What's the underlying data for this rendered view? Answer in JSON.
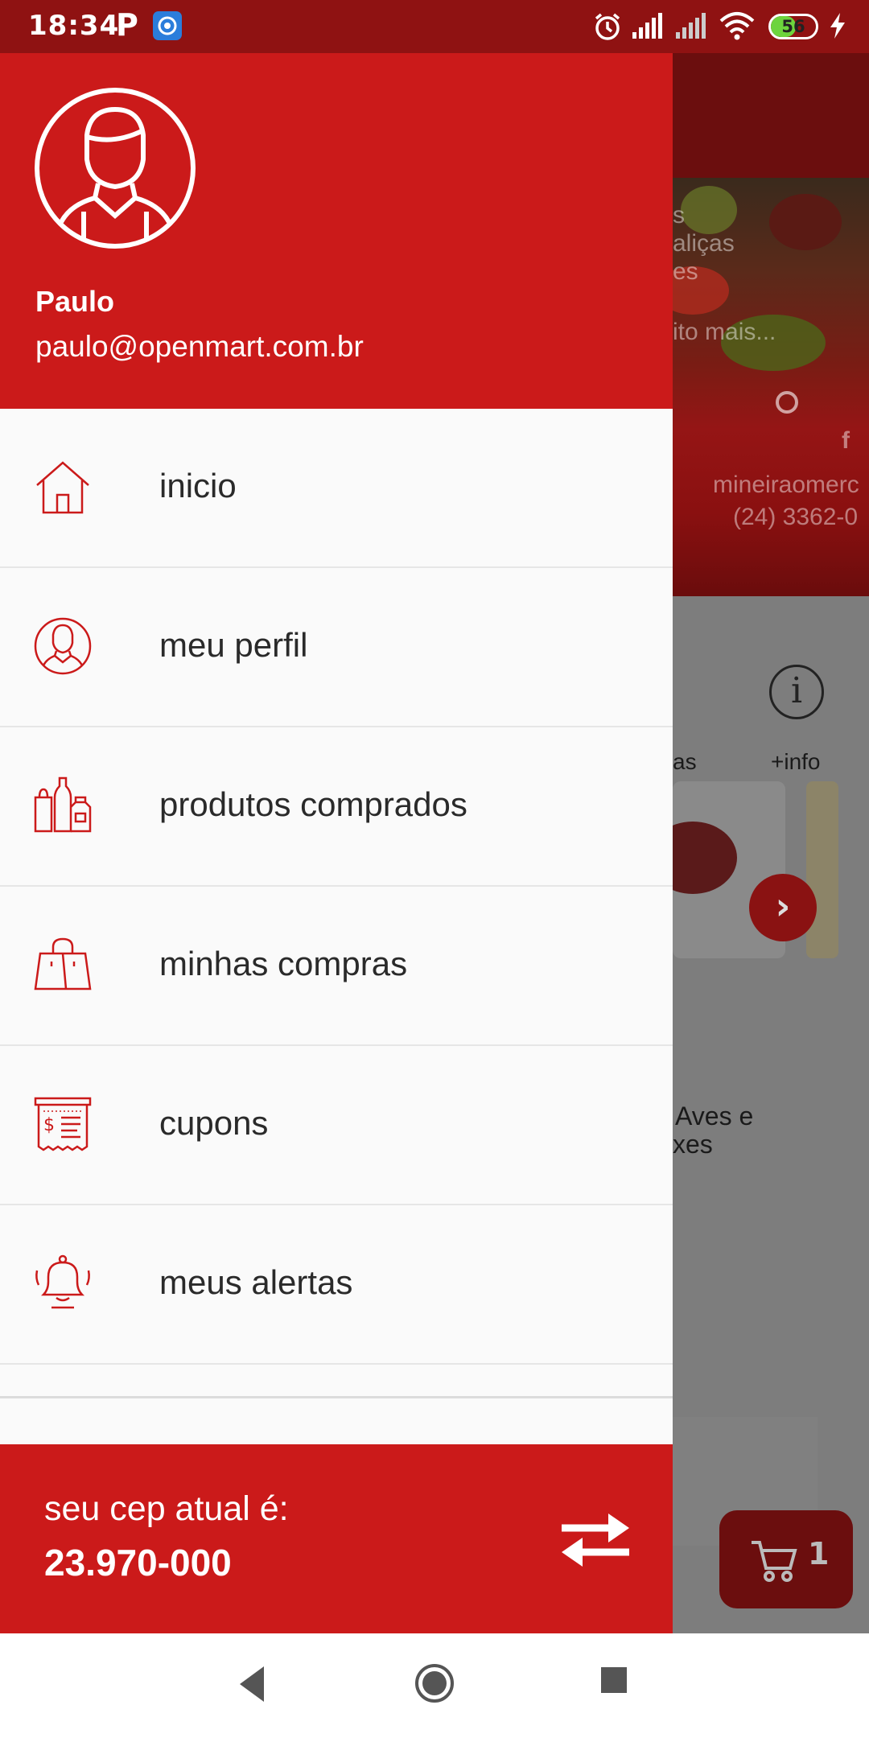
{
  "status_bar": {
    "time": "18:34",
    "p_label": "P",
    "battery": "56",
    "battery_level": 0.56,
    "icons": [
      "alarm-icon",
      "signal-icon",
      "signal-icon",
      "wifi-icon",
      "charging-icon"
    ]
  },
  "drawer": {
    "user": {
      "name": "Paulo",
      "email": "paulo@openmart.com.br"
    },
    "menu": [
      {
        "label": "inicio",
        "icon": "home-icon"
      },
      {
        "label": "meu perfil",
        "icon": "profile-icon"
      },
      {
        "label": "produtos comprados",
        "icon": "products-icon"
      },
      {
        "label": "minhas compras",
        "icon": "shopping-bags-icon"
      },
      {
        "label": "cupons",
        "icon": "coupon-icon"
      },
      {
        "label": "meus alertas",
        "icon": "bell-icon"
      }
    ],
    "cep": {
      "label": "seu cep atual é:",
      "value": "23.970-000"
    }
  },
  "background": {
    "banner_lines": [
      "s",
      "aliças",
      "es",
      "ito mais...",
      "mineiraomerc",
      "(24) 3362-0"
    ],
    "info_label": "+info",
    "partial_label": "as",
    "product_title_1": "Aves e",
    "product_title_2": "xes",
    "cart_count": "1"
  },
  "colors": {
    "primary": "#cb1a1a",
    "status_bar": "#8f1212",
    "drawer_bg": "#fafafa",
    "text": "#2a2a2a"
  }
}
